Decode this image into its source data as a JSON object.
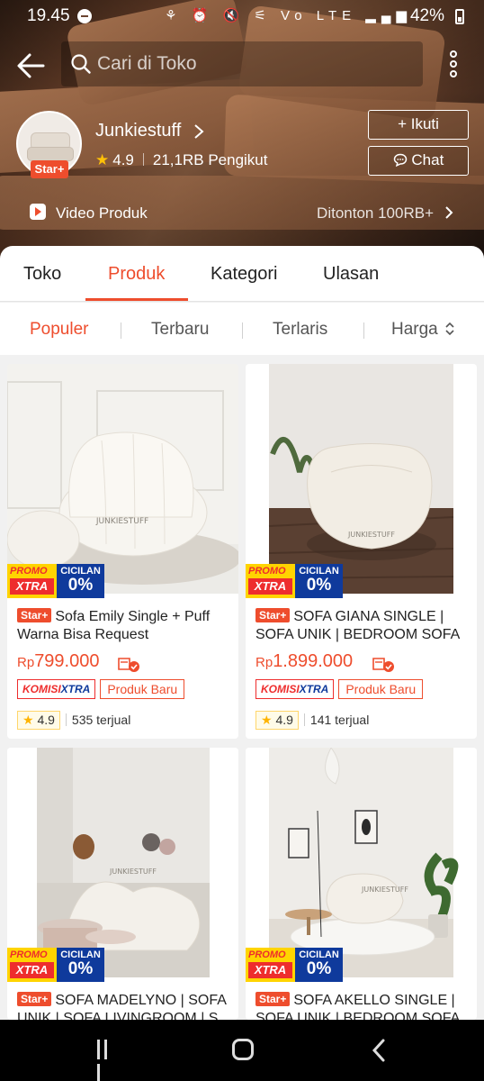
{
  "status": {
    "time": "19.45",
    "battery": "42%",
    "icons": "⚘ ⏰ 🔇 ⚟ Vo LTE ▂▄▆"
  },
  "search": {
    "placeholder": "Cari di Toko"
  },
  "shop": {
    "name": "Junkiestuff",
    "badge": "Star+",
    "rating": "4.9",
    "followers": "21,1RB Pengikut",
    "follow_label": "Ikuti",
    "chat_label": "Chat"
  },
  "video": {
    "label": "Video Produk",
    "views": "Ditonton 100RB+"
  },
  "tabs": [
    "Toko",
    "Produk",
    "Kategori",
    "Ulasan"
  ],
  "sort": [
    "Populer",
    "Terbaru",
    "Terlaris",
    "Harga"
  ],
  "promo": {
    "promo": "PROMO",
    "xtra": "XTRA",
    "cicilan": "CICILAN",
    "zero": "0%"
  },
  "products": [
    {
      "badge": "Star+",
      "title": "Sofa Emily Single + Puff Warna Bisa Request",
      "currency": "Rp",
      "price": "799.000",
      "tag_komisi_a": "KOMISI",
      "tag_komisi_b": "XTRA",
      "tag_baru": "Produk Baru",
      "rating": "4.9",
      "sold": "535 terjual",
      "watermark": "JUNKIESTUFF"
    },
    {
      "badge": "Star+",
      "title": "SOFA GIANA SINGLE | SOFA UNIK | BEDROOM SOFA",
      "currency": "Rp",
      "price": "1.899.000",
      "tag_komisi_a": "KOMISI",
      "tag_komisi_b": "XTRA",
      "tag_baru": "Produk Baru",
      "rating": "4.9",
      "sold": "141 terjual",
      "watermark": "JUNKIESTUFF"
    },
    {
      "badge": "Star+",
      "title": "SOFA MADELYNO | SOFA UNIK | SOFA LIVINGROOM | S",
      "watermark": "JUNKIESTUFF"
    },
    {
      "badge": "Star+",
      "title": "SOFA AKELLO SINGLE | SOFA UNIK | BEDROOM SOFA",
      "watermark": "JUNKIESTUFF"
    }
  ]
}
